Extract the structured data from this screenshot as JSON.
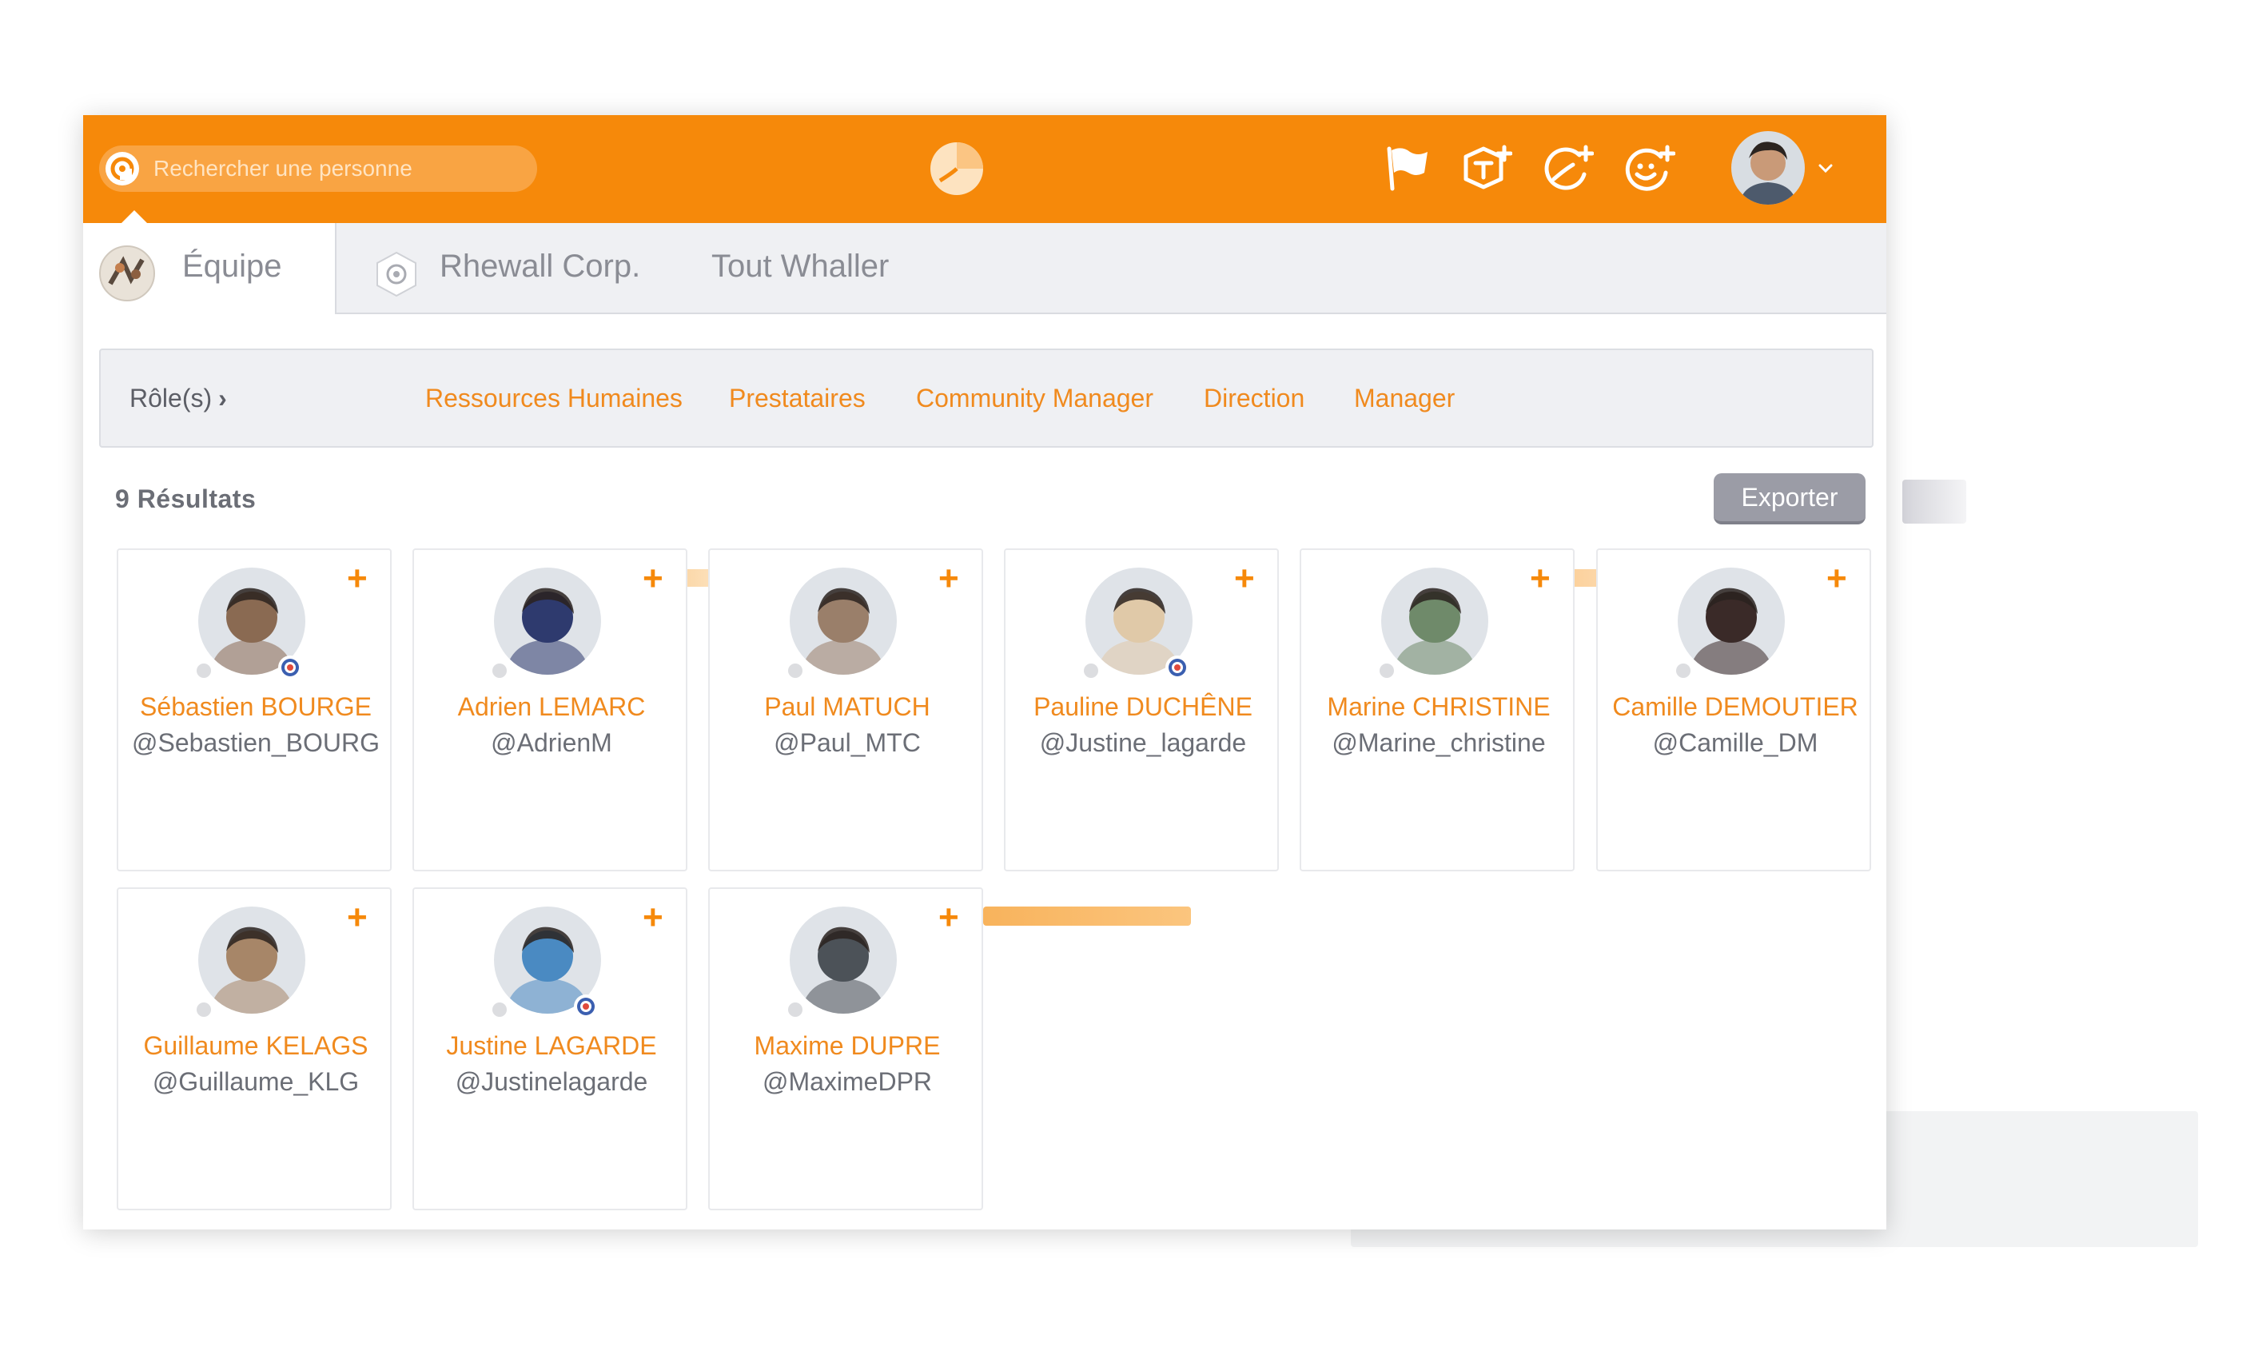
{
  "search": {
    "placeholder": "Rechercher une personne"
  },
  "tabs": [
    {
      "label": "Équipe",
      "active": true
    },
    {
      "label": "Rhewall Corp.",
      "active": false
    },
    {
      "label": "Tout Whaller",
      "active": false
    }
  ],
  "filters": {
    "roles_label": "Rôle(s)",
    "roles_arrow": "›",
    "roles": [
      "Ressources Humaines",
      "Prestataires",
      "Community Manager",
      "Direction",
      "Manager"
    ]
  },
  "results": {
    "count_label": "9 Résultats",
    "export_label": "Exporter"
  },
  "add_symbol": "+",
  "members": [
    {
      "name": "Sébastien BOURGE",
      "handle": "@Sebastien_BOURG",
      "badge": true,
      "color": "#8a6a52"
    },
    {
      "name": "Adrien LEMARC",
      "handle": "@AdrienM",
      "badge": false,
      "color": "#2e3a6e"
    },
    {
      "name": "Paul MATUCH",
      "handle": "@Paul_MTC",
      "badge": false,
      "color": "#9a7f6a"
    },
    {
      "name": "Pauline DUCHÊNE",
      "handle": "@Justine_lagarde",
      "badge": true,
      "color": "#e0c9a8"
    },
    {
      "name": "Marine CHRISTINE",
      "handle": "@Marine_christine",
      "badge": false,
      "color": "#6f8a6a"
    },
    {
      "name": "Camille DEMOUTIER",
      "handle": "@Camille_DM",
      "badge": false,
      "color": "#3a2a28"
    },
    {
      "name": "Guillaume KELAGS",
      "handle": "@Guillaume_KLG",
      "badge": false,
      "color": "#a78668"
    },
    {
      "name": "Justine LAGARDE",
      "handle": "@Justinelagarde",
      "badge": true,
      "color": "#4a8ac2"
    },
    {
      "name": "Maxime DUPRE",
      "handle": "@MaximeDPR",
      "badge": false,
      "color": "#4c5258"
    }
  ],
  "colors": {
    "brand": "#f6890a",
    "link": "#f08a1e",
    "muted": "#6b6e76"
  }
}
